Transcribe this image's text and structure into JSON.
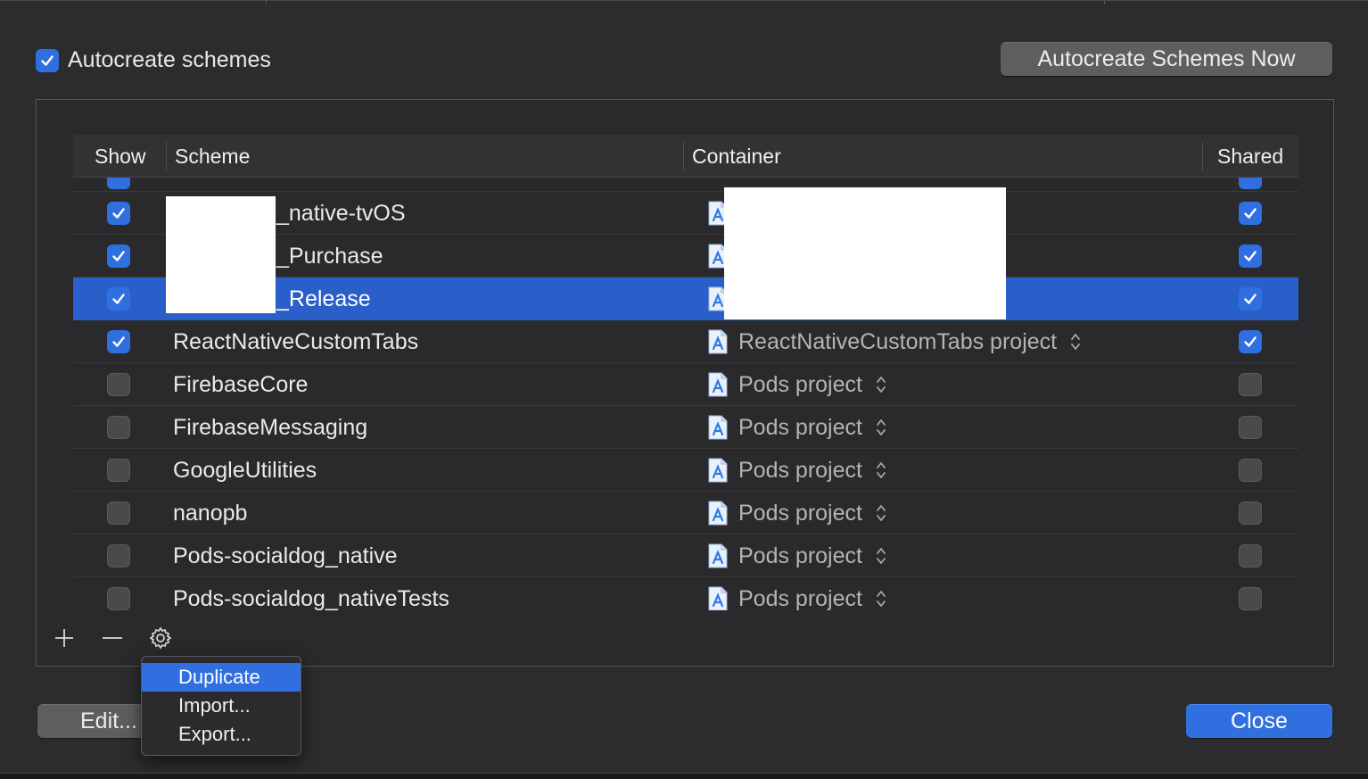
{
  "autocreate": {
    "label": "Autocreate schemes",
    "checked": true
  },
  "autocreate_now_button": "Autocreate Schemes Now",
  "table": {
    "headers": {
      "show": "Show",
      "scheme": "Scheme",
      "container": "Container",
      "shared": "Shared"
    },
    "rows": [
      {
        "show": true,
        "name": "_native-tvOS",
        "redacted": true,
        "container": "",
        "shared": true,
        "selected": false
      },
      {
        "show": true,
        "name": "_Purchase",
        "redacted": true,
        "container": "",
        "shared": true,
        "selected": false
      },
      {
        "show": true,
        "name": "_Release",
        "redacted": true,
        "container": "",
        "shared": true,
        "selected": true
      },
      {
        "show": true,
        "name": "ReactNativeCustomTabs",
        "container": "ReactNativeCustomTabs project",
        "shared": true,
        "selected": false
      },
      {
        "show": false,
        "name": "FirebaseCore",
        "container": "Pods project",
        "shared": false,
        "selected": false
      },
      {
        "show": false,
        "name": "FirebaseMessaging",
        "container": "Pods project",
        "shared": false,
        "selected": false
      },
      {
        "show": false,
        "name": "GoogleUtilities",
        "container": "Pods project",
        "shared": false,
        "selected": false
      },
      {
        "show": false,
        "name": "nanopb",
        "container": "Pods project",
        "shared": false,
        "selected": false
      },
      {
        "show": false,
        "name": "Pods-socialdog_native",
        "container": "Pods project",
        "shared": false,
        "selected": false
      },
      {
        "show": false,
        "name": "Pods-socialdog_nativeTests",
        "container": "Pods project",
        "shared": false,
        "selected": false
      }
    ]
  },
  "context_menu": {
    "items": [
      "Duplicate",
      "Import...",
      "Export..."
    ],
    "highlighted": "Duplicate"
  },
  "buttons": {
    "edit": "Edit...",
    "close": "Close"
  },
  "colors": {
    "accent": "#2f6fe0",
    "selection": "#2a5fc9",
    "sheet_bg": "#2c2c2e"
  }
}
